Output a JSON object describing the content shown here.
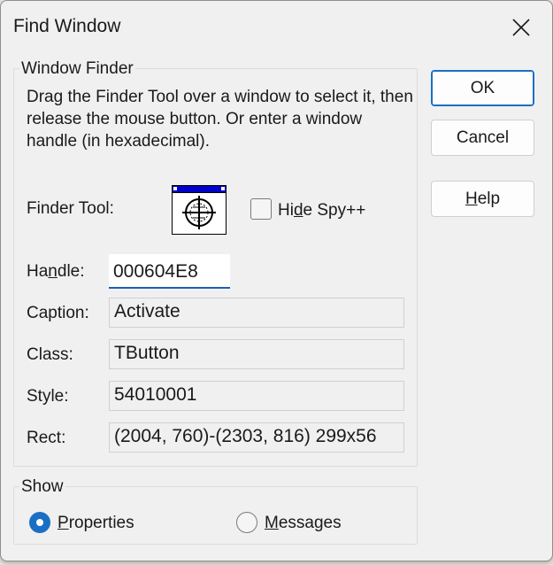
{
  "title": "Find Window",
  "window_finder": {
    "group_label": "Window Finder",
    "description": "Drag the Finder Tool over a window to select it, then release the mouse button.  Or enter a window handle (in hexadecimal).",
    "finder_tool_label": "Finder Tool:",
    "hide_spy": {
      "label_pre": "Hi",
      "label_access": "d",
      "label_post": "e Spy++",
      "checked": false
    },
    "fields": {
      "handle": {
        "label_pre": "Ha",
        "label_access": "n",
        "label_post": "dle:",
        "value": "000604E8"
      },
      "caption": {
        "label": "Caption:",
        "value": "Activate"
      },
      "class": {
        "label": "Class:",
        "value": "TButton"
      },
      "style": {
        "label": "Style:",
        "value": "54010001"
      },
      "rect": {
        "label": "Rect:",
        "value": "(2004, 760)-(2303, 816) 299x56"
      }
    }
  },
  "show": {
    "group_label": "Show",
    "properties": {
      "label_access": "P",
      "label_post": "roperties",
      "selected": true
    },
    "messages": {
      "label_access": "M",
      "label_post": "essages",
      "selected": false
    }
  },
  "buttons": {
    "ok": "OK",
    "cancel": "Cancel",
    "help_access": "H",
    "help_post": "elp"
  },
  "colors": {
    "accent": "#1a6fc4",
    "dialog_bg": "#f0f0f0"
  },
  "icons": {
    "close": "close-icon",
    "finder": "crosshair-finder-icon"
  }
}
